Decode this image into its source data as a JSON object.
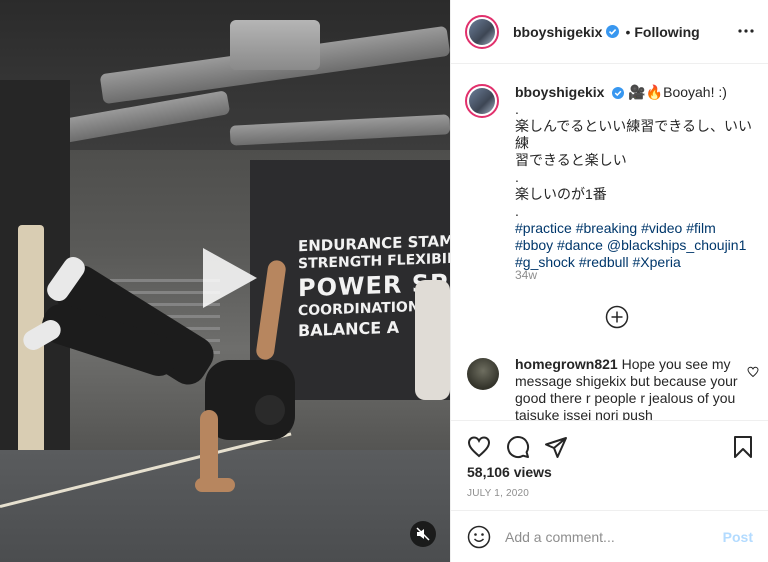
{
  "post": {
    "username": "bboyshigekix",
    "follow_separator": "•",
    "follow_status": "Following",
    "caption": {
      "username": "bboyshigekix",
      "lines": [
        "🎥🔥Booyah! :)",
        ".",
        "楽しんでるといい練習できるし、いい練",
        "習できると楽しい",
        ".",
        "楽しいのが1番",
        "."
      ],
      "hashtag_lines": [
        "#practice #breaking #video #film",
        "#bboy #dance @blackships_choujin1",
        "#g_shock #redbull #Xperia"
      ],
      "age": "34w"
    },
    "comment": {
      "username": "homegrown821",
      "text": "Hope you see my message shigekix but because your good there r people r jealous of you taisuke issei nori push"
    },
    "views": "58,106 views",
    "date": "JULY 1, 2020",
    "add_comment_placeholder": "Add a comment...",
    "post_label": "Post"
  },
  "video": {
    "wall_text": [
      "ENDURANCE STAMINA",
      "STRENGTH FLEXIBILI",
      "POWER SPE",
      "COORDINATION AG",
      "BALANCE A"
    ]
  },
  "icons": {
    "verified": "verified-badge-icon",
    "more": "more-options-icon",
    "load_more": "load-more-comments-icon",
    "like": "heart-icon",
    "comment": "comment-icon",
    "share": "share-icon",
    "save": "bookmark-icon",
    "emoji": "emoji-icon",
    "play": "play-icon",
    "mute": "muted-speaker-icon"
  },
  "colors": {
    "verified_blue": "#3897f0",
    "hashtag": "#00376b",
    "post_disabled": "#b3dbff",
    "avatar_ring": "#e1306c"
  }
}
